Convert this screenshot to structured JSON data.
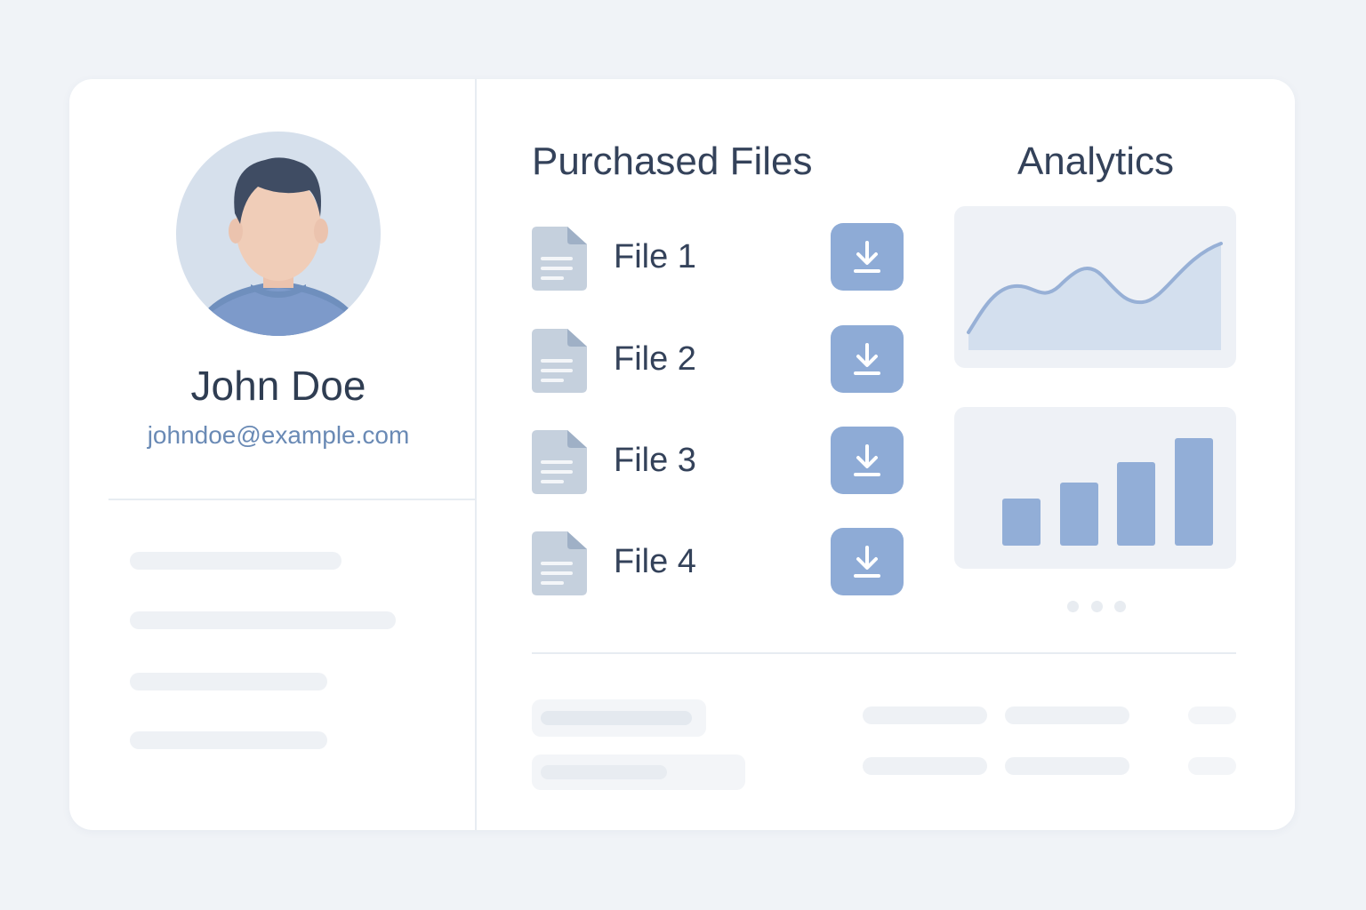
{
  "profile": {
    "name": "John Doe",
    "email": "johndoe@example.com"
  },
  "files": {
    "title": "Purchased Files",
    "items": [
      {
        "label": "File 1"
      },
      {
        "label": "File 2"
      },
      {
        "label": "File 3"
      },
      {
        "label": "File 4"
      }
    ],
    "download_icon": "download-icon",
    "file_icon": "document-icon"
  },
  "analytics": {
    "title": "Analytics"
  },
  "colors": {
    "accent": "#8eabd6",
    "text": "#34425a",
    "email": "#6a8ab5",
    "background": "#f0f3f7"
  }
}
